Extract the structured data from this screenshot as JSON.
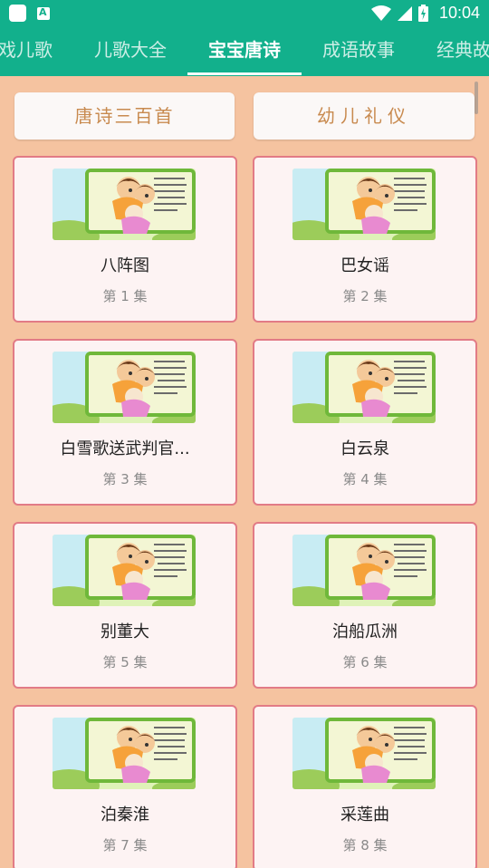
{
  "status_bar": {
    "time": "10:04",
    "icons": [
      "app-square-icon",
      "a-badge-icon",
      "wifi-icon",
      "signal-icon",
      "battery-icon"
    ]
  },
  "tabs": [
    {
      "label": "戏儿歌",
      "active": false
    },
    {
      "label": "儿歌大全",
      "active": false
    },
    {
      "label": "宝宝唐诗",
      "active": true
    },
    {
      "label": "成语故事",
      "active": false
    },
    {
      "label": "经典故",
      "active": false
    }
  ],
  "category_buttons": [
    {
      "label": "唐诗三百首"
    },
    {
      "label": "幼儿礼仪"
    }
  ],
  "cards": [
    {
      "title": "八阵图",
      "episode": "第 1 集"
    },
    {
      "title": "巴女谣",
      "episode": "第 2 集"
    },
    {
      "title": "白雪歌送武判官...",
      "episode": "第 3 集"
    },
    {
      "title": "白云泉",
      "episode": "第 4 集"
    },
    {
      "title": "别董大",
      "episode": "第 5 集"
    },
    {
      "title": "泊船瓜洲",
      "episode": "第 6 集"
    },
    {
      "title": "泊秦淮",
      "episode": "第 7 集"
    },
    {
      "title": "采莲曲",
      "episode": "第 8 集"
    }
  ],
  "colors": {
    "app_bar": "#12b08c",
    "background": "#f5c3a0",
    "card_border": "#e27b86",
    "card_fill": "#fdf3f3",
    "button_text": "#c88a4f"
  }
}
